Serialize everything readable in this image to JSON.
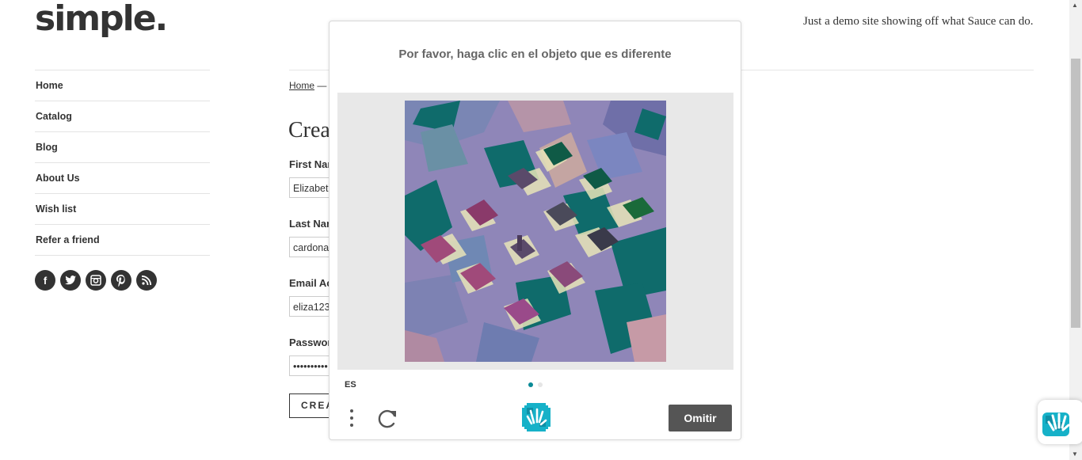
{
  "site": {
    "logo": "simple.",
    "tagline": "Just a demo site showing off what Sauce can do."
  },
  "nav": {
    "items": [
      "Home",
      "Catalog",
      "Blog",
      "About Us",
      "Wish list",
      "Refer a friend"
    ]
  },
  "social": [
    "facebook-icon",
    "twitter-icon",
    "instagram-icon",
    "pinterest-icon",
    "rss-icon"
  ],
  "breadcrumb": {
    "home": "Home",
    "separator": "—"
  },
  "form": {
    "title": "Crea",
    "first_name_label": "First Nan",
    "first_name_value": "Elizabet",
    "last_name_label": "Last Nan",
    "last_name_value": "cardona",
    "email_label": "Email Ac",
    "email_value": "eliza123",
    "password_label": "Passwor",
    "password_value": "••••••••••",
    "create_button": "CREA"
  },
  "captcha": {
    "prompt": "Por favor, haga clic en el objeto que es diferente",
    "language": "ES",
    "skip_button": "Omitir",
    "accent_color": "#0a8a96",
    "page_dots": 2,
    "active_dot": 0
  }
}
